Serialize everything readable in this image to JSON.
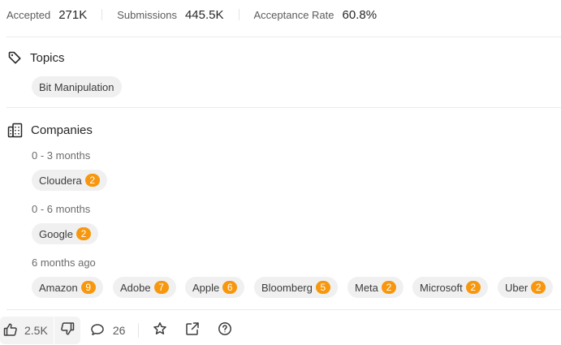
{
  "stats": {
    "accepted_label": "Accepted",
    "accepted_value": "271K",
    "submissions_label": "Submissions",
    "submissions_value": "445.5K",
    "acceptance_label": "Acceptance Rate",
    "acceptance_value": "60.8%"
  },
  "topics": {
    "title": "Topics",
    "items": [
      {
        "label": "Bit Manipulation"
      }
    ]
  },
  "companies": {
    "title": "Companies",
    "groups": [
      {
        "period": "0 - 3 months",
        "items": [
          {
            "label": "Cloudera",
            "count": "2"
          }
        ]
      },
      {
        "period": "0 - 6 months",
        "items": [
          {
            "label": "Google",
            "count": "2"
          }
        ]
      },
      {
        "period": "6 months ago",
        "items": [
          {
            "label": "Amazon",
            "count": "9"
          },
          {
            "label": "Adobe",
            "count": "7"
          },
          {
            "label": "Apple",
            "count": "6"
          },
          {
            "label": "Bloomberg",
            "count": "5"
          },
          {
            "label": "Meta",
            "count": "2"
          },
          {
            "label": "Microsoft",
            "count": "2"
          },
          {
            "label": "Uber",
            "count": "2"
          }
        ]
      }
    ]
  },
  "footer": {
    "likes": "2.5K",
    "comments": "26"
  },
  "colors": {
    "badge": "#f7970d",
    "chip_bg": "#f0f0f0",
    "text": "#262626"
  }
}
